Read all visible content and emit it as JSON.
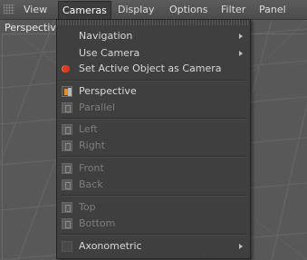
{
  "menubar": {
    "items": [
      "View",
      "Cameras",
      "Display",
      "Options",
      "Filter",
      "Panel"
    ],
    "active": "Cameras"
  },
  "viewport": {
    "label": "Perspective"
  },
  "cameras_menu": {
    "navigation": "Navigation",
    "use_camera": "Use Camera",
    "set_active": "Set Active Object as Camera",
    "perspective": "Perspective",
    "parallel": "Parallel",
    "left": "Left",
    "right": "Right",
    "front": "Front",
    "back": "Back",
    "top": "Top",
    "bottom": "Bottom",
    "axonometric": "Axonometric"
  },
  "colors": {
    "menubar_bg": "#545454",
    "dropdown_bg": "#3f3f3f",
    "enabled_text": "#d8d8d8",
    "disabled_text": "#7d7d7d",
    "accent_orange": "#e68a1e",
    "accent_red": "#e0391c"
  }
}
